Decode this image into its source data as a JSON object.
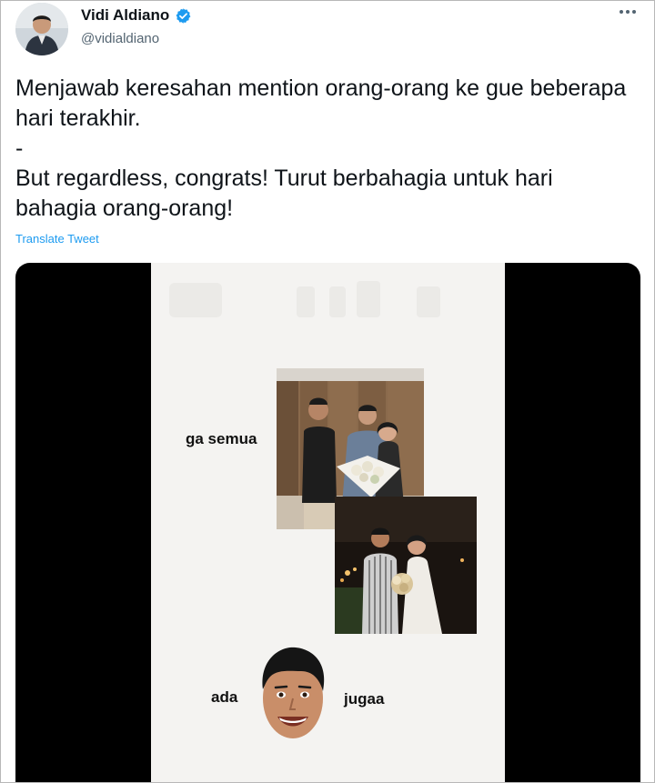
{
  "author": {
    "display_name": "Vidi Aldiano",
    "handle": "@vidialdiano",
    "verified_icon": "verified-badge-icon",
    "avatar_icon": "profile-photo"
  },
  "tweet": {
    "lines": [
      "Menjawab keresahan mention orang-orang ke gue beberapa hari terakhir.",
      "-",
      "But regardless, congrats! Turut berbahagia untuk hari bahagia orang-orang!"
    ],
    "translate_label": "Translate Tweet"
  },
  "media": {
    "captions": {
      "left_top": "ga semua",
      "left_bottom": "ada",
      "right_bottom": "jugaa"
    }
  },
  "colors": {
    "link": "#1d9bf0",
    "verified": "#1d9bf0",
    "secondary_text": "#536471",
    "media_background": "#000000",
    "panel_background": "#f4f3f1"
  }
}
